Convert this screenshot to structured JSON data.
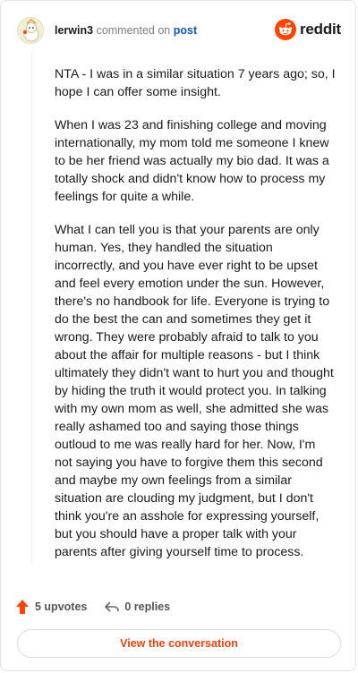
{
  "header": {
    "username": "lerwin3",
    "commented_on": "commented on",
    "post_link": "post",
    "brand": "reddit",
    "avatar_icon": "snoo-avatar-icon",
    "brand_icon": "reddit-alien-icon"
  },
  "comment": {
    "paragraphs": [
      "NTA - I was in a similar situation 7 years ago; so, I hope I can offer some insight.",
      "When I was 23 and finishing college and moving internationally, my mom told me someone I knew to be her friend was actually my bio dad. It was a totally shock and didn't know how to process my feelings for quite a while.",
      "What I can tell you is that your parents are only human. Yes, they handled the situation incorrectly, and you have ever right to be upset and feel every emotion under the sun. However, there's no handbook for life. Everyone is trying to do the best the can and sometimes they get it wrong. They were probably afraid to talk to you about the affair for multiple reasons - but I think ultimately they didn't want to hurt you and thought by hiding the truth it would protect you. In talking with my own mom as well, she admitted she was really ashamed too and saying those things outloud to me was really hard for her. Now, I'm not saying you have to forgive them this second and maybe my own feelings from a similar situation are clouding my judgment, but I don't think you're an asshole for expressing yourself, but you should have a proper talk with your parents after giving yourself time to process."
    ]
  },
  "footer": {
    "upvotes": "5 upvotes",
    "replies": "0 replies",
    "upvote_icon": "upvote-arrow-icon",
    "reply_icon": "reply-arrow-icon",
    "cta": "View the conversation"
  },
  "colors": {
    "accent": "#ff4500",
    "link": "#0f55b8"
  }
}
